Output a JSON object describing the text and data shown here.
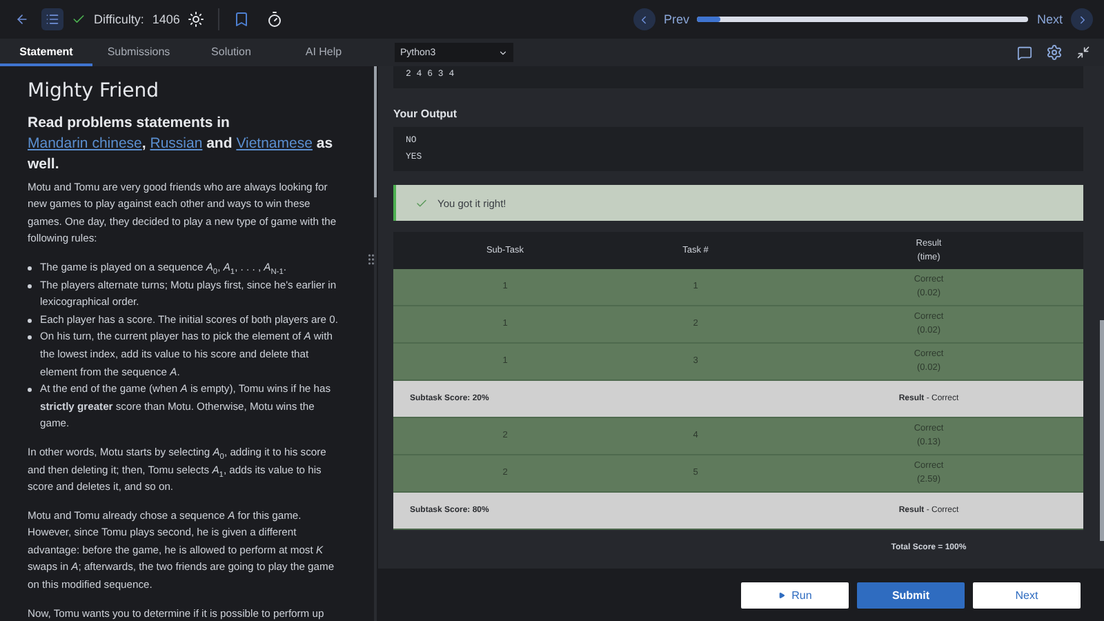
{
  "topbar": {
    "difficulty_label": "Difficulty:",
    "difficulty": "1406",
    "solved": true,
    "prev": "Prev",
    "next": "Next",
    "progress": {
      "level": 0.07
    }
  },
  "tabs": [
    {
      "label": "Statement",
      "selected": true
    },
    {
      "label": "Submissions",
      "selected": false
    },
    {
      "label": "Solution",
      "selected": false
    },
    {
      "label": "AI Help",
      "selected": false
    }
  ],
  "language": "Python3",
  "statement": {
    "title": "Mighty Friend",
    "heading": [
      {
        "text": "Read problems statements in ",
        "link": false
      },
      {
        "text": "Mandarin chinese",
        "link": true
      },
      {
        "text": ", ",
        "link": false
      },
      {
        "text": "Russian",
        "link": true
      },
      {
        "text": " and ",
        "link": false
      },
      {
        "text": "Vietnamese",
        "link": true
      },
      {
        "text": " as well.",
        "link": false
      }
    ],
    "intro": "Motu and Tomu are very good friends who are always looking for new games to play against each other and ways to win these games. One day, they decided to play a new type of game with the following rules:",
    "rules": [
      "The game is played on a sequence *A*$_{0}$, *A*$_{1}$, . . . , *A*$_{N-1}$.",
      "The players alternate turns; Motu plays first, since he's earlier in lexicographical order.",
      "Each player has a score. The initial scores of both players are 0.",
      "On his turn, the current player has to pick the element of *A* with the lowest index, add its value to his score and delete that element from the sequence *A*.",
      "At the end of the game (when *A* is empty), Tomu wins if he has **strictly greater** score than Motu. Otherwise, Motu wins the game."
    ],
    "paragraphs": [
      "In other words, Motu starts by selecting *A*$_{0}$, adding it to his score and then deleting it; then, Tomu selects *A*$_{1}$, adds its value to his score and deletes it, and so on.",
      "Motu and Tomu already chose a sequence *A* for this game. However, since Tomu plays second, he is given a different advantage: before the game, he is allowed to perform at most *K* swaps in *A*; afterwards, the two friends are going to play the game on this modified sequence.",
      "Now, Tomu wants you to determine if it is possible to perform up"
    ]
  },
  "input_lines": [
    "2 4 6 3 4"
  ],
  "output": {
    "label": "Your Output",
    "lines": [
      "NO",
      "YES"
    ]
  },
  "verdict": {
    "text": "You got it right!",
    "success": true
  },
  "table": {
    "columns": [
      {
        "label": "Sub-Task"
      },
      {
        "label": "Task #"
      },
      {
        "label": "Result",
        "note": "(time)"
      }
    ],
    "rows": [
      {
        "kind": "task",
        "subtask": "1",
        "task": "1",
        "result": "Correct",
        "time": "(0.02)"
      },
      {
        "kind": "task",
        "subtask": "1",
        "task": "2",
        "result": "Correct",
        "time": "(0.02)"
      },
      {
        "kind": "task",
        "subtask": "1",
        "task": "3",
        "result": "Correct",
        "time": "(0.02)"
      },
      {
        "kind": "summary",
        "score": "Subtask Score: 20%",
        "result": "**Result** - Correct"
      },
      {
        "kind": "task",
        "subtask": "2",
        "task": "4",
        "result": "Correct",
        "time": "(0.13)"
      },
      {
        "kind": "task",
        "subtask": "2",
        "task": "5",
        "result": "Correct",
        "time": "(2.59)"
      },
      {
        "kind": "summary",
        "score": "Subtask Score: 80%",
        "result": "**Result** - Correct"
      },
      {
        "kind": "total",
        "total": "Total Score = 100%"
      }
    ]
  },
  "actions": [
    {
      "label": "Run",
      "kind": "run"
    },
    {
      "label": "Submit",
      "kind": "primary"
    },
    {
      "label": "Next",
      "kind": "plain"
    }
  ]
}
